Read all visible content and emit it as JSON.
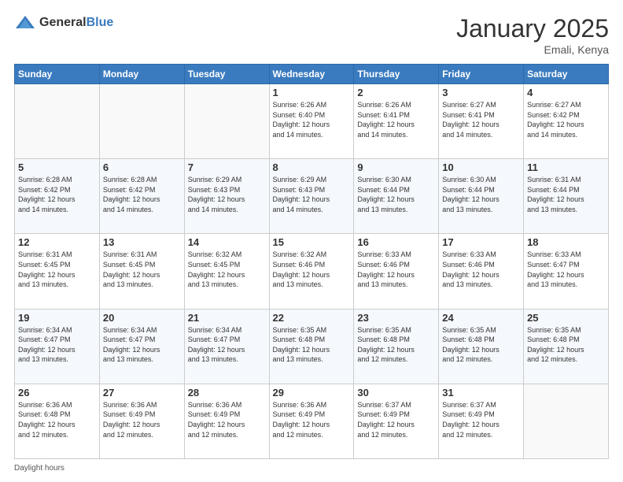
{
  "header": {
    "logo_general": "General",
    "logo_blue": "Blue",
    "month": "January 2025",
    "location": "Emali, Kenya"
  },
  "days_of_week": [
    "Sunday",
    "Monday",
    "Tuesday",
    "Wednesday",
    "Thursday",
    "Friday",
    "Saturday"
  ],
  "weeks": [
    [
      {
        "day": "",
        "info": ""
      },
      {
        "day": "",
        "info": ""
      },
      {
        "day": "",
        "info": ""
      },
      {
        "day": "1",
        "info": "Sunrise: 6:26 AM\nSunset: 6:40 PM\nDaylight: 12 hours\nand 14 minutes."
      },
      {
        "day": "2",
        "info": "Sunrise: 6:26 AM\nSunset: 6:41 PM\nDaylight: 12 hours\nand 14 minutes."
      },
      {
        "day": "3",
        "info": "Sunrise: 6:27 AM\nSunset: 6:41 PM\nDaylight: 12 hours\nand 14 minutes."
      },
      {
        "day": "4",
        "info": "Sunrise: 6:27 AM\nSunset: 6:42 PM\nDaylight: 12 hours\nand 14 minutes."
      }
    ],
    [
      {
        "day": "5",
        "info": "Sunrise: 6:28 AM\nSunset: 6:42 PM\nDaylight: 12 hours\nand 14 minutes."
      },
      {
        "day": "6",
        "info": "Sunrise: 6:28 AM\nSunset: 6:42 PM\nDaylight: 12 hours\nand 14 minutes."
      },
      {
        "day": "7",
        "info": "Sunrise: 6:29 AM\nSunset: 6:43 PM\nDaylight: 12 hours\nand 14 minutes."
      },
      {
        "day": "8",
        "info": "Sunrise: 6:29 AM\nSunset: 6:43 PM\nDaylight: 12 hours\nand 14 minutes."
      },
      {
        "day": "9",
        "info": "Sunrise: 6:30 AM\nSunset: 6:44 PM\nDaylight: 12 hours\nand 13 minutes."
      },
      {
        "day": "10",
        "info": "Sunrise: 6:30 AM\nSunset: 6:44 PM\nDaylight: 12 hours\nand 13 minutes."
      },
      {
        "day": "11",
        "info": "Sunrise: 6:31 AM\nSunset: 6:44 PM\nDaylight: 12 hours\nand 13 minutes."
      }
    ],
    [
      {
        "day": "12",
        "info": "Sunrise: 6:31 AM\nSunset: 6:45 PM\nDaylight: 12 hours\nand 13 minutes."
      },
      {
        "day": "13",
        "info": "Sunrise: 6:31 AM\nSunset: 6:45 PM\nDaylight: 12 hours\nand 13 minutes."
      },
      {
        "day": "14",
        "info": "Sunrise: 6:32 AM\nSunset: 6:45 PM\nDaylight: 12 hours\nand 13 minutes."
      },
      {
        "day": "15",
        "info": "Sunrise: 6:32 AM\nSunset: 6:46 PM\nDaylight: 12 hours\nand 13 minutes."
      },
      {
        "day": "16",
        "info": "Sunrise: 6:33 AM\nSunset: 6:46 PM\nDaylight: 12 hours\nand 13 minutes."
      },
      {
        "day": "17",
        "info": "Sunrise: 6:33 AM\nSunset: 6:46 PM\nDaylight: 12 hours\nand 13 minutes."
      },
      {
        "day": "18",
        "info": "Sunrise: 6:33 AM\nSunset: 6:47 PM\nDaylight: 12 hours\nand 13 minutes."
      }
    ],
    [
      {
        "day": "19",
        "info": "Sunrise: 6:34 AM\nSunset: 6:47 PM\nDaylight: 12 hours\nand 13 minutes."
      },
      {
        "day": "20",
        "info": "Sunrise: 6:34 AM\nSunset: 6:47 PM\nDaylight: 12 hours\nand 13 minutes."
      },
      {
        "day": "21",
        "info": "Sunrise: 6:34 AM\nSunset: 6:47 PM\nDaylight: 12 hours\nand 13 minutes."
      },
      {
        "day": "22",
        "info": "Sunrise: 6:35 AM\nSunset: 6:48 PM\nDaylight: 12 hours\nand 13 minutes."
      },
      {
        "day": "23",
        "info": "Sunrise: 6:35 AM\nSunset: 6:48 PM\nDaylight: 12 hours\nand 12 minutes."
      },
      {
        "day": "24",
        "info": "Sunrise: 6:35 AM\nSunset: 6:48 PM\nDaylight: 12 hours\nand 12 minutes."
      },
      {
        "day": "25",
        "info": "Sunrise: 6:35 AM\nSunset: 6:48 PM\nDaylight: 12 hours\nand 12 minutes."
      }
    ],
    [
      {
        "day": "26",
        "info": "Sunrise: 6:36 AM\nSunset: 6:48 PM\nDaylight: 12 hours\nand 12 minutes."
      },
      {
        "day": "27",
        "info": "Sunrise: 6:36 AM\nSunset: 6:49 PM\nDaylight: 12 hours\nand 12 minutes."
      },
      {
        "day": "28",
        "info": "Sunrise: 6:36 AM\nSunset: 6:49 PM\nDaylight: 12 hours\nand 12 minutes."
      },
      {
        "day": "29",
        "info": "Sunrise: 6:36 AM\nSunset: 6:49 PM\nDaylight: 12 hours\nand 12 minutes."
      },
      {
        "day": "30",
        "info": "Sunrise: 6:37 AM\nSunset: 6:49 PM\nDaylight: 12 hours\nand 12 minutes."
      },
      {
        "day": "31",
        "info": "Sunrise: 6:37 AM\nSunset: 6:49 PM\nDaylight: 12 hours\nand 12 minutes."
      },
      {
        "day": "",
        "info": ""
      }
    ]
  ],
  "footer": {
    "daylight_label": "Daylight hours"
  }
}
